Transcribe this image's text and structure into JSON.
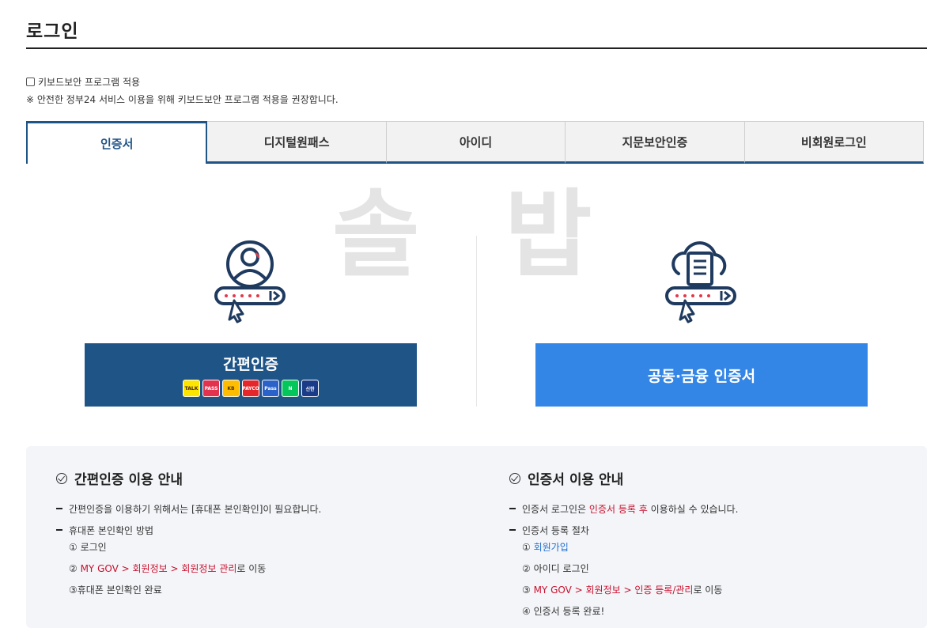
{
  "page": {
    "title": "로그인"
  },
  "keyboard_security": {
    "label": "키보드보안 프로그램 적용",
    "notice": "※ 안전한 정부24 서비스 이용을 위해 키보드보안 프로그램 적용을 권장합니다."
  },
  "tabs": [
    {
      "label": "인증서",
      "active": true
    },
    {
      "label": "디지털원패스",
      "active": false
    },
    {
      "label": "아이디",
      "active": false
    },
    {
      "label": "지문보안인증",
      "active": false
    },
    {
      "label": "비회원로그인",
      "active": false
    }
  ],
  "watermark": {
    "left": "솔",
    "right": "밥"
  },
  "options": {
    "simple_auth_label": "간편인증",
    "simple_auth_providers": [
      {
        "name": "TALK",
        "color": "#fee500",
        "text_color": "#3b1e1e"
      },
      {
        "name": "PASS",
        "color": "#e3324d",
        "text_color": "#ffffff"
      },
      {
        "name": "KB",
        "color": "#ffbc00",
        "text_color": "#4a3a00"
      },
      {
        "name": "PAYCO",
        "color": "#e5262b",
        "text_color": "#ffffff"
      },
      {
        "name": "Pass",
        "color": "#2a62c9",
        "text_color": "#ffffff"
      },
      {
        "name": "N",
        "color": "#03c75a",
        "text_color": "#ffffff"
      },
      {
        "name": "신한",
        "color": "#1a3b88",
        "text_color": "#ffffff"
      }
    ],
    "cert_label": "공동·금융 인증서"
  },
  "guide_simple": {
    "title": "간편인증 이용 안내",
    "item1": "간편인증을 이용하기 위해서는 [휴대폰 본인확인]이 필요합니다.",
    "item2": "휴대폰 본인확인 방법",
    "step1": "① 로그인",
    "step2_prefix": "② ",
    "step2_link": "MY GOV > 회원정보 > 회원정보 관리",
    "step2_suffix": "로 이동",
    "step3": "③휴대폰 본인확인 완료"
  },
  "guide_cert": {
    "title": "인증서 이용 안내",
    "item1_prefix": "인증서 로그인은 ",
    "item1_link": "인증서 등록 후",
    "item1_suffix": " 이용하실 수 있습니다.",
    "item2": "인증서 등록 절차",
    "step1_prefix": "① ",
    "step1_link": "회원가입",
    "step2": "② 아이디 로그인",
    "step3_prefix": "③ ",
    "step3_link": "MY GOV > 회원정보 > 인증 등록/관리",
    "step3_suffix": "로 이동",
    "step4": "④ 인증서 등록 완료!"
  },
  "colors": {
    "primary_dark": "#1f5487",
    "primary_light": "#3486e6",
    "highlight_red": "#c8102e",
    "link_blue": "#1e6fd0"
  }
}
